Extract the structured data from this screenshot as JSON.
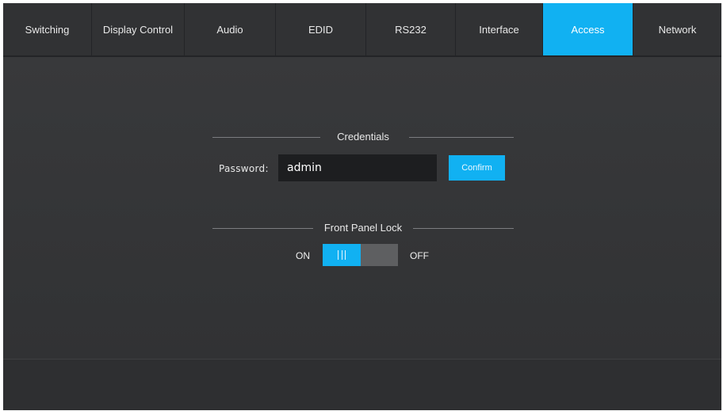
{
  "nav": {
    "tabs": [
      {
        "label": "Switching",
        "active": false
      },
      {
        "label": "Display Control",
        "active": false
      },
      {
        "label": "Audio",
        "active": false
      },
      {
        "label": "EDID",
        "active": false
      },
      {
        "label": "RS232",
        "active": false
      },
      {
        "label": "Interface",
        "active": false
      },
      {
        "label": "Access",
        "active": true
      },
      {
        "label": "Network",
        "active": false
      }
    ]
  },
  "credentials": {
    "title": "Credentials",
    "password_label": "Password:",
    "password_value": "admin",
    "confirm_label": "Confirm"
  },
  "front_panel_lock": {
    "title": "Front Panel Lock",
    "on_label": "ON",
    "off_label": "OFF",
    "state": "on"
  },
  "colors": {
    "accent": "#11b1f2",
    "background": "#303133",
    "input_background": "#1d1e20",
    "toggle_off": "#5e5f61"
  }
}
